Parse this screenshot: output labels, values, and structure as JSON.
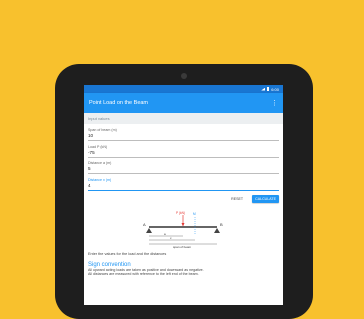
{
  "appbar": {
    "title": "Point Load on the Beam",
    "menu_glyph": "⋮"
  },
  "statusbar": {
    "time": "6:00"
  },
  "section": {
    "input_values": "Input values"
  },
  "fields": [
    {
      "label": "Span of beam (m)",
      "value": "10"
    },
    {
      "label": "Load P (kN)",
      "value": "-75"
    },
    {
      "label": "Distance a (m)",
      "value": "5"
    },
    {
      "label": "Distance x (m)",
      "value": "4"
    }
  ],
  "actions": {
    "reset": "RESET",
    "calculate": "CALCULATE"
  },
  "diagram": {
    "load_label": "P (kN)",
    "m_label": "M",
    "support_a": "A",
    "support_b": "B",
    "dim_a": "a",
    "dim_x": "x",
    "span_label": "span of beam"
  },
  "caption": "Enter the values for the load and the distances",
  "sign": {
    "title": "Sign convention",
    "line1": "All upward acting loads are taken as positive and downward as negative.",
    "line2": "All distances are measured with reference to the left end of the beam."
  },
  "colors": {
    "primary": "#2196F3",
    "primary_dark": "#1976D2",
    "background": "#F8C12D",
    "load_arrow": "#E53935"
  }
}
